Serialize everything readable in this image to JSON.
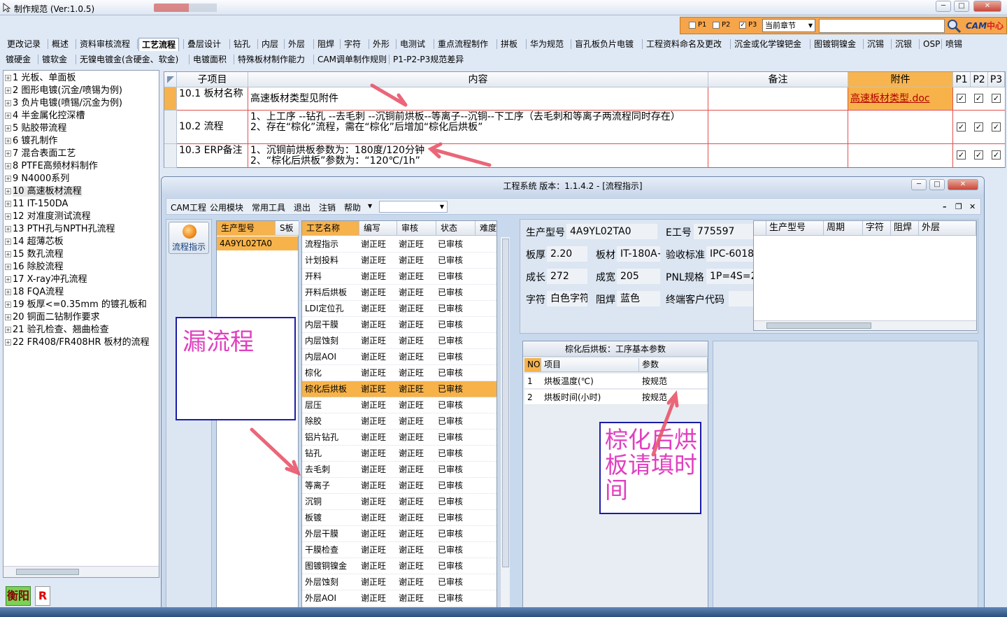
{
  "window": {
    "title": "制作规范 (Ver:1.0.5)"
  },
  "filter": {
    "p1": "P1",
    "p2": "P2",
    "p3": "P3",
    "p3_checked": true,
    "chapter": "当前章节"
  },
  "logo": {
    "cam": "CAM",
    "center": "中心"
  },
  "tabs_row1": [
    "更改记录",
    "概述",
    "资料审核流程",
    "工艺流程",
    "叠层设计",
    "钻孔",
    "内层",
    "外层",
    "阻焊",
    "字符",
    "外形",
    "电测试",
    "重点流程制作",
    "拼板",
    "华为规范",
    "盲孔板负片电镀",
    "工程资料命名及更改",
    "沉金或化学镍钯金",
    "图镀铜镍金",
    "沉锡",
    "沉银",
    "OSP",
    "喷锡"
  ],
  "tabs_row1_active": "工艺流程",
  "tabs_row2": [
    "镀硬金",
    "镀软金",
    "无镍电镀金(含硬金、软金)",
    "电镀面积",
    "特殊板材制作能力",
    "CAM调单制作规则",
    "P1-P2-P3规范差异"
  ],
  "tree": [
    {
      "label": "1 光板、单面板"
    },
    {
      "label": "2 图形电镀(沉金/喷锡为例)"
    },
    {
      "label": "3 负片电镀(喷锡/沉金为例)"
    },
    {
      "label": "4 半金属化控深槽"
    },
    {
      "label": "5 贴胶带流程"
    },
    {
      "label": "6 镀孔制作"
    },
    {
      "label": "7 混合表面工艺"
    },
    {
      "label": "8 PTFE高频材料制作"
    },
    {
      "label": "9 N4000系列"
    },
    {
      "label": "10 高速板材流程"
    },
    {
      "label": "11 IT-150DA"
    },
    {
      "label": "12 对准度测试流程"
    },
    {
      "label": "13 PTH孔与NPTH孔流程"
    },
    {
      "label": "14 超薄芯板"
    },
    {
      "label": "15 数孔流程"
    },
    {
      "label": "16 除胶流程"
    },
    {
      "label": "17 X-ray冲孔流程"
    },
    {
      "label": "18 FQA流程"
    },
    {
      "label": "19 板厚<=0.35mm 的镀孔板和"
    },
    {
      "label": "20 铜面二钻制作要求"
    },
    {
      "label": "21 验孔检查、翘曲检查"
    },
    {
      "label": "22 FR408/FR408HR 板材的流程"
    }
  ],
  "tree_selected": 9,
  "grid": {
    "headers": {
      "item": "子项目",
      "content": "内容",
      "note": "备注",
      "attach": "附件",
      "p1": "P1",
      "p2": "P2",
      "p3": "P3"
    },
    "rows": [
      {
        "item": "10.1 板材名称",
        "content": "高速板材类型见附件",
        "note": "",
        "attach": "高速板材类型.doc"
      },
      {
        "item": "10.2 流程",
        "content": "1、上工序 --钻孔 --去毛刺 --沉铜前烘板--等离子--沉铜--下工序（去毛刺和等离子两流程同时存在）\n2、存在“棕化”流程，需在“棕化”后增加“棕化后烘板”",
        "note": "",
        "attach": ""
      },
      {
        "item": "10.3 ERP备注",
        "content": "1、沉铜前烘板参数为：180度/120分钟\n2、“棕化后烘板”参数为：“120℃/1h”",
        "note": "",
        "attach": ""
      }
    ]
  },
  "dialog": {
    "title": "工程系统   版本：1.1.4.2 - [流程指示]",
    "menus": [
      "CAM工程",
      "公用模块",
      "常用工具",
      "退出",
      "注销",
      "帮助"
    ],
    "flow_button": "流程指示",
    "model_headers": [
      "生产型号",
      "S板"
    ],
    "model_value": "4A9YL02TA0",
    "note1": "漏流程",
    "proc_headers": [
      "工艺名称",
      "编写",
      "审核",
      "状态",
      "难度"
    ],
    "processes": [
      {
        "name": "流程指示",
        "author": "谢正旺",
        "reviewer": "谢正旺",
        "status": "已审核"
      },
      {
        "name": "计划投料",
        "author": "谢正旺",
        "reviewer": "谢正旺",
        "status": "已审核"
      },
      {
        "name": "开料",
        "author": "谢正旺",
        "reviewer": "谢正旺",
        "status": "已审核"
      },
      {
        "name": "开料后烘板",
        "author": "谢正旺",
        "reviewer": "谢正旺",
        "status": "已审核"
      },
      {
        "name": "LDI定位孔",
        "author": "谢正旺",
        "reviewer": "谢正旺",
        "status": "已审核"
      },
      {
        "name": "内层干膜",
        "author": "谢正旺",
        "reviewer": "谢正旺",
        "status": "已审核"
      },
      {
        "name": "内层蚀刻",
        "author": "谢正旺",
        "reviewer": "谢正旺",
        "status": "已审核"
      },
      {
        "name": "内层AOI",
        "author": "谢正旺",
        "reviewer": "谢正旺",
        "status": "已审核"
      },
      {
        "name": "棕化",
        "author": "谢正旺",
        "reviewer": "谢正旺",
        "status": "已审核"
      },
      {
        "name": "棕化后烘板",
        "author": "谢正旺",
        "reviewer": "谢正旺",
        "status": "已审核"
      },
      {
        "name": "层压",
        "author": "谢正旺",
        "reviewer": "谢正旺",
        "status": "已审核"
      },
      {
        "name": "除胶",
        "author": "谢正旺",
        "reviewer": "谢正旺",
        "status": "已审核"
      },
      {
        "name": "铝片钻孔",
        "author": "谢正旺",
        "reviewer": "谢正旺",
        "status": "已审核"
      },
      {
        "name": "钻孔",
        "author": "谢正旺",
        "reviewer": "谢正旺",
        "status": "已审核"
      },
      {
        "name": "去毛刺",
        "author": "谢正旺",
        "reviewer": "谢正旺",
        "status": "已审核"
      },
      {
        "name": "等离子",
        "author": "谢正旺",
        "reviewer": "谢正旺",
        "status": "已审核"
      },
      {
        "name": "沉铜",
        "author": "谢正旺",
        "reviewer": "谢正旺",
        "status": "已审核"
      },
      {
        "name": "板镀",
        "author": "谢正旺",
        "reviewer": "谢正旺",
        "status": "已审核"
      },
      {
        "name": "外层干膜",
        "author": "谢正旺",
        "reviewer": "谢正旺",
        "status": "已审核"
      },
      {
        "name": "干膜检查",
        "author": "谢正旺",
        "reviewer": "谢正旺",
        "status": "已审核"
      },
      {
        "name": "图镀铜镍金",
        "author": "谢正旺",
        "reviewer": "谢正旺",
        "status": "已审核"
      },
      {
        "name": "外层蚀刻",
        "author": "谢正旺",
        "reviewer": "谢正旺",
        "status": "已审核"
      },
      {
        "name": "外层AOI",
        "author": "谢正旺",
        "reviewer": "谢正旺",
        "status": "已审核"
      }
    ],
    "proc_selected": 9,
    "info": {
      "model_label": "生产型号",
      "model": "4A9YL02TA0",
      "e_label": "E工号",
      "e_no": "775597",
      "thick_label": "板厚",
      "thick": "2.20",
      "material_label": "板材",
      "material": "IT-180A+",
      "std_label": "验收标准",
      "std": "IPC-6018",
      "len_label": "成长",
      "len": "272",
      "wid_label": "成宽",
      "wid": "205",
      "pnl_label": "PNL规格",
      "pnl": "1P=4S=2",
      "char_label": "字符",
      "char": "白色字符",
      "mask_label": "阻焊",
      "mask": "蓝色",
      "cust_label": "终端客户代码",
      "cust": ""
    },
    "right_headers": [
      "生产型号",
      "周期",
      "字符",
      "阻焊",
      "外层"
    ],
    "param_title": "棕化后烘板：工序基本参数",
    "param_headers": [
      "NO",
      "项目",
      "参数"
    ],
    "params": [
      {
        "no": "1",
        "item": "烘板温度(℃)",
        "value": "按规范"
      },
      {
        "no": "2",
        "item": "烘板时间(小时)",
        "value": "按规范"
      }
    ],
    "note2": "棕化后烘板请填时间"
  },
  "status": {
    "city": "衡阳",
    "r": "R"
  },
  "colors": {
    "accent": "#f6a54b",
    "selection": "#f7b349",
    "annotation": "#e040c0",
    "arrow": "#e8566a"
  }
}
